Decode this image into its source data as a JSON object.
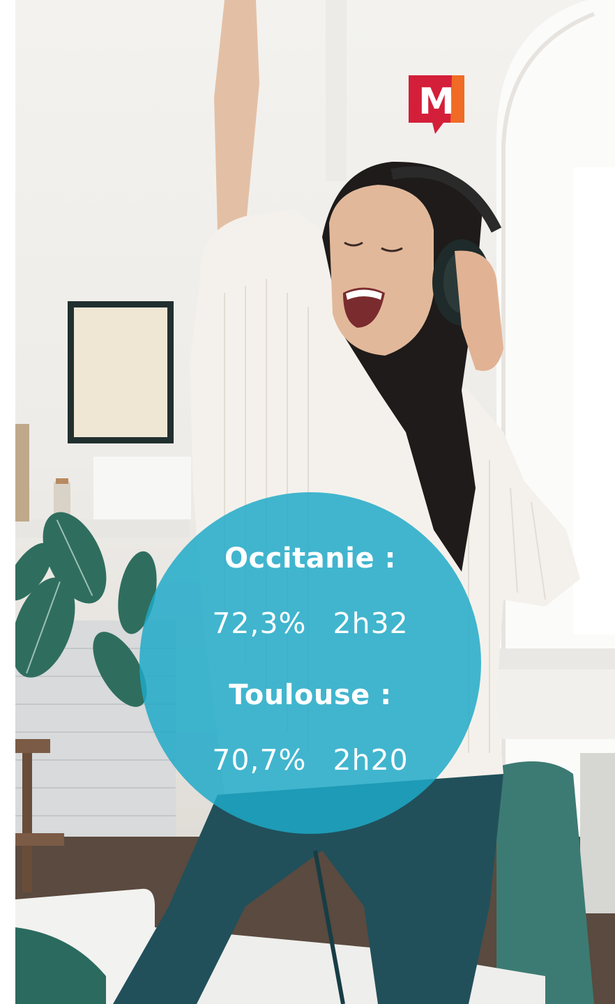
{
  "logo": {
    "letter": "M",
    "icon": "brand-logo-icon",
    "colors": {
      "primary": "#d41f3a",
      "accent": "#f06b25"
    }
  },
  "photo": {
    "icon": "woman-with-headphones-photo"
  },
  "stats": [
    {
      "region": "Occitanie :",
      "percent": "72,3%",
      "duration": "2h32"
    },
    {
      "region": "Toulouse :",
      "percent": "70,7%",
      "duration": "2h20"
    }
  ],
  "colors": {
    "circle": "#1ea9c8",
    "text": "#ffffff"
  }
}
